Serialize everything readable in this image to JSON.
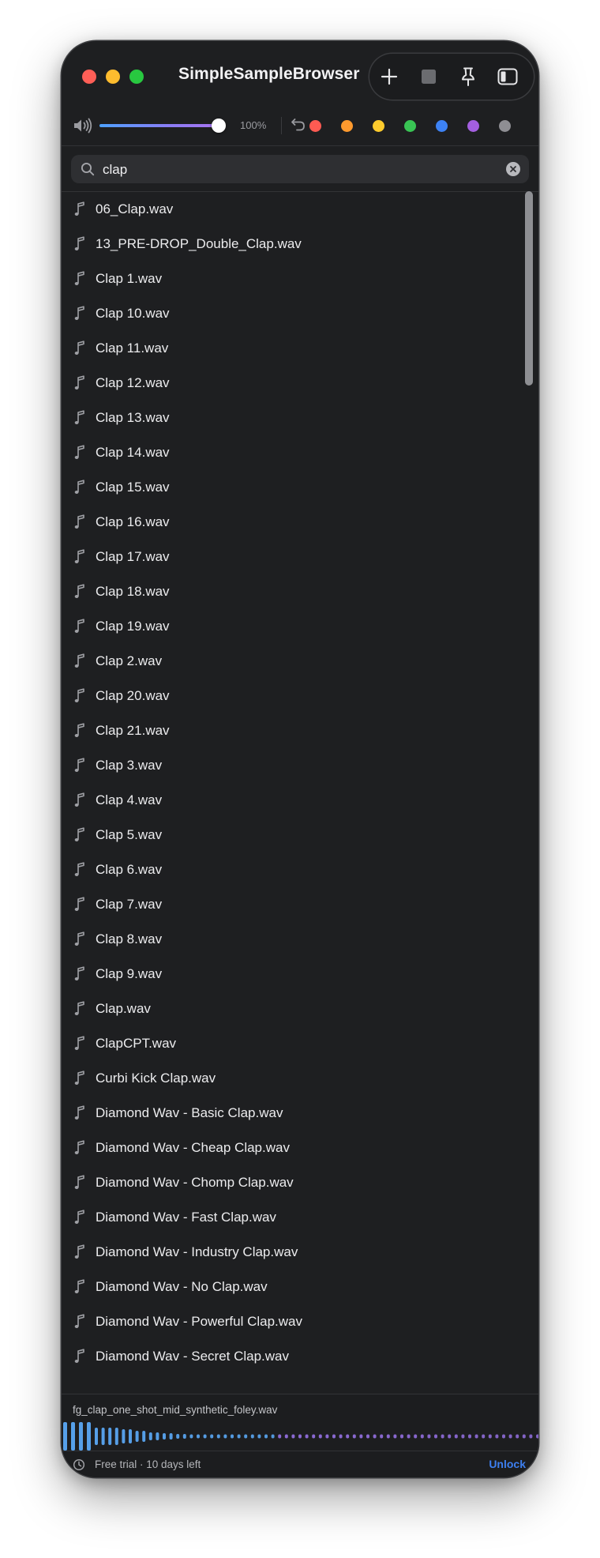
{
  "window": {
    "title": "SimpleSampleBrowser"
  },
  "toolbar": {
    "icons": [
      "plus-icon",
      "stop-icon",
      "pin-icon",
      "sidebar-icon"
    ]
  },
  "volume": {
    "level": 1.0,
    "percent_label": "100%"
  },
  "color_swatches": [
    "#ff5b52",
    "#ff9a2e",
    "#fdcb2d",
    "#39c454",
    "#3d82f4",
    "#a45fe0",
    "#8e8e93"
  ],
  "search": {
    "value": "clap",
    "placeholder": ""
  },
  "files": [
    "06_Clap.wav",
    "13_PRE-DROP_Double_Clap.wav",
    "Clap 1.wav",
    "Clap 10.wav",
    "Clap 11.wav",
    "Clap 12.wav",
    "Clap 13.wav",
    "Clap 14.wav",
    "Clap 15.wav",
    "Clap 16.wav",
    "Clap 17.wav",
    "Clap 18.wav",
    "Clap 19.wav",
    "Clap 2.wav",
    "Clap 20.wav",
    "Clap 21.wav",
    "Clap 3.wav",
    "Clap 4.wav",
    "Clap 5.wav",
    "Clap 6.wav",
    "Clap 7.wav",
    "Clap 8.wav",
    "Clap 9.wav",
    "Clap.wav",
    "ClapCPT.wav",
    "Curbi Kick Clap.wav",
    "Diamond Wav - Basic Clap.wav",
    "Diamond Wav - Cheap Clap.wav",
    "Diamond Wav - Chomp Clap.wav",
    "Diamond Wav - Fast Clap.wav",
    "Diamond Wav - Industry Clap.wav",
    "Diamond Wav - No Clap.wav",
    "Diamond Wav - Powerful Clap.wav",
    "Diamond Wav - Secret Clap.wav"
  ],
  "preview": {
    "file_name": "fg_clap_one_shot_mid_synthetic_foley.wav",
    "waveform_colors": [
      "#5aa8f5",
      "#9a74ec"
    ]
  },
  "status": {
    "trial_text": "Free trial · 10 days left",
    "unlock_label": "Unlock",
    "accent": "#3d7ff0"
  }
}
